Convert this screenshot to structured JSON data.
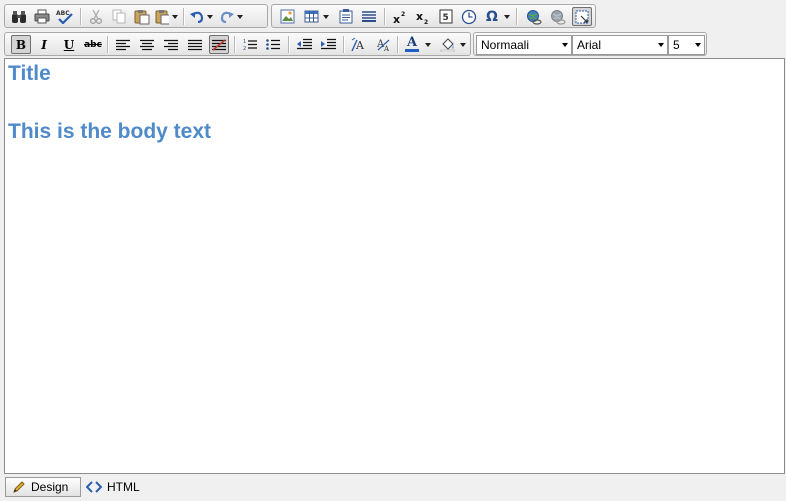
{
  "toolbar": {
    "row1": [
      {
        "name": "find-button",
        "icon": "binoculars-icon"
      },
      {
        "name": "print-button",
        "icon": "printer-icon"
      },
      {
        "name": "spellcheck-button",
        "icon": "spellcheck-icon",
        "text": "ABC"
      },
      {
        "name": "cut-button",
        "icon": "scissors-icon"
      },
      {
        "name": "copy-button",
        "icon": "copy-icon"
      },
      {
        "name": "paste-button",
        "icon": "paste-icon"
      },
      {
        "name": "paste-special-button",
        "icon": "paste-dropdown-icon"
      },
      {
        "name": "undo-button",
        "icon": "undo-icon"
      },
      {
        "name": "redo-button",
        "icon": "redo-icon"
      },
      {
        "name": "insert-image-button",
        "icon": "image-icon"
      },
      {
        "name": "insert-table-button",
        "icon": "table-icon"
      },
      {
        "name": "insert-form-button",
        "icon": "form-icon"
      },
      {
        "name": "horizontal-rule-button",
        "icon": "paragraph-icon"
      },
      {
        "name": "superscript-button",
        "icon": "superscript-icon"
      },
      {
        "name": "subscript-button",
        "icon": "subscript-icon"
      },
      {
        "name": "insert-symbol-box-button",
        "icon": "symbol-box-icon"
      },
      {
        "name": "insert-date-button",
        "icon": "clock-icon"
      },
      {
        "name": "special-char-button",
        "icon": "omega-icon",
        "text": "Ω"
      },
      {
        "name": "insert-link-button",
        "icon": "globe-link-icon"
      },
      {
        "name": "remove-link-button",
        "icon": "globe-unlink-icon"
      },
      {
        "name": "show-borders-button",
        "icon": "select-frame-icon"
      }
    ],
    "format": {
      "bold": "B",
      "italic": "I",
      "underline": "U",
      "strike": "abc",
      "font_color_letter": "A"
    },
    "paragraph_style": "Normaali",
    "font_name": "Arial",
    "font_size": "5"
  },
  "colors": {
    "text_accent": "#4f8ac9",
    "font_color_bar": "#1f5fbf"
  },
  "document": {
    "title": "Title",
    "body": "This is the body text"
  },
  "modes": {
    "design": "Design",
    "html": "HTML"
  }
}
